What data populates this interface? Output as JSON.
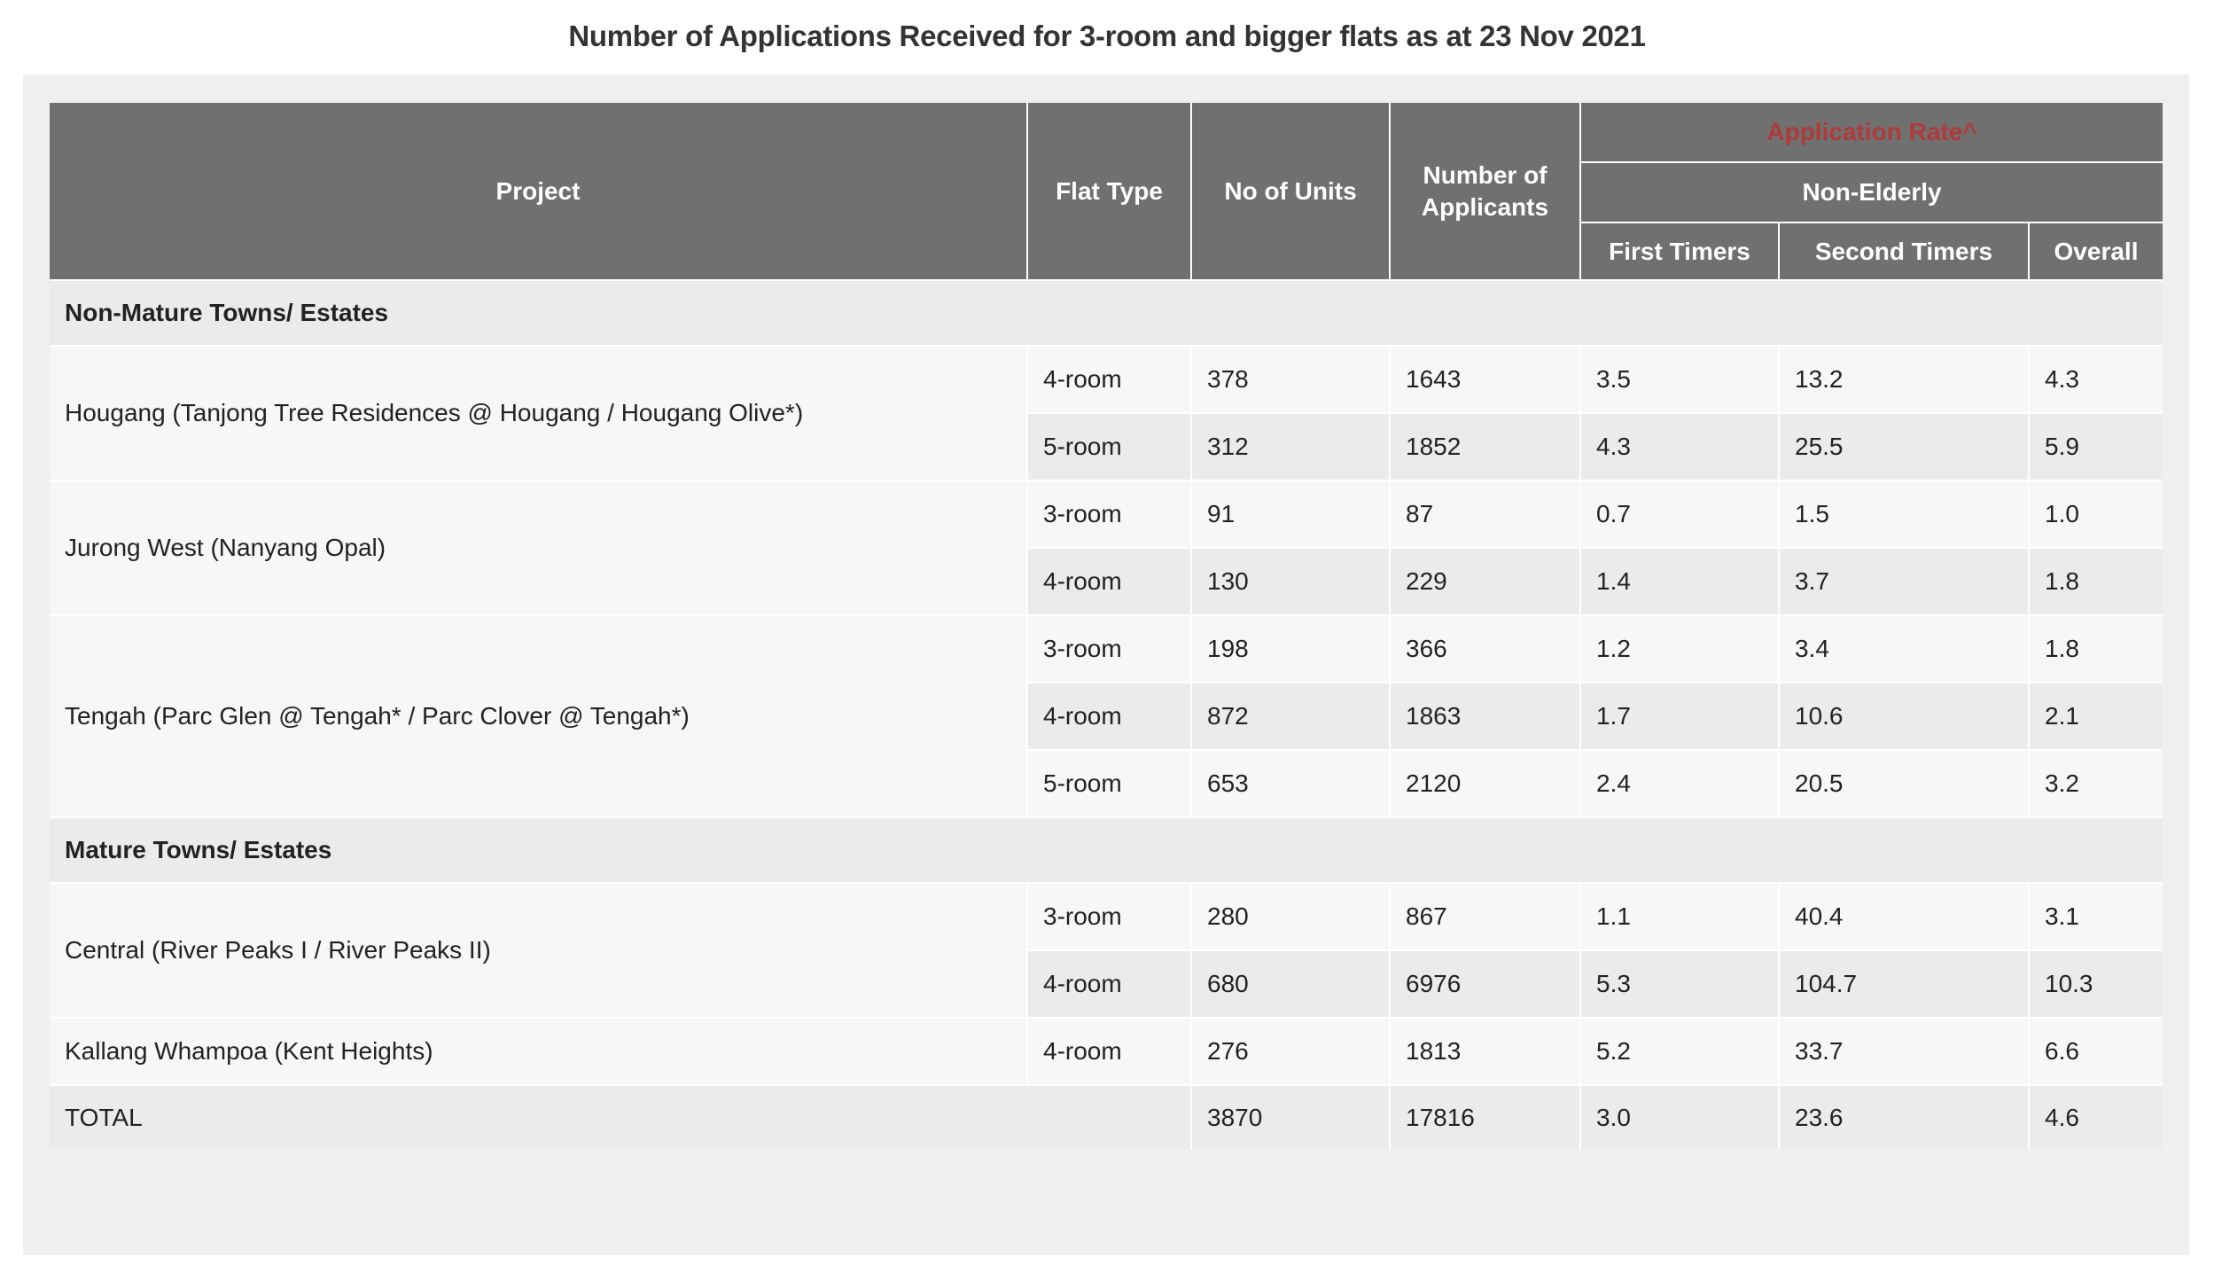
{
  "page": {
    "title": "Number of Applications Received for 3-room and bigger flats as at 23 Nov 2021"
  },
  "colors": {
    "header_bg": "#707070",
    "header_text": "#ffffff",
    "accent_red": "#b03a3a",
    "panel_bg": "#efefef",
    "row_light": "#f7f7f7",
    "row_dark": "#ebebeb"
  },
  "table": {
    "headers": {
      "project": "Project",
      "flat_type": "Flat Type",
      "no_of_units": "No of Units",
      "number_of_applicants": "Number of Applicants",
      "application_rate": "Application Rate^",
      "non_elderly": "Non-Elderly",
      "first_timers": "First Timers",
      "second_timers": "Second Timers",
      "overall": "Overall"
    },
    "sections": [
      {
        "title": "Non-Mature Towns/ Estates",
        "projects": [
          {
            "name": "Hougang (Tanjong Tree Residences @ Hougang / Hougang Olive*)",
            "rows": [
              {
                "flat_type": "4-room",
                "units": "378",
                "applicants": "1643",
                "first_timers": "3.5",
                "second_timers": "13.2",
                "overall": "4.3"
              },
              {
                "flat_type": "5-room",
                "units": "312",
                "applicants": "1852",
                "first_timers": "4.3",
                "second_timers": "25.5",
                "overall": "5.9"
              }
            ]
          },
          {
            "name": "Jurong West (Nanyang Opal)",
            "rows": [
              {
                "flat_type": "3-room",
                "units": "91",
                "applicants": "87",
                "first_timers": "0.7",
                "second_timers": "1.5",
                "overall": "1.0"
              },
              {
                "flat_type": "4-room",
                "units": "130",
                "applicants": "229",
                "first_timers": "1.4",
                "second_timers": "3.7",
                "overall": "1.8"
              }
            ]
          },
          {
            "name": "Tengah (Parc Glen @ Tengah* / Parc Clover @ Tengah*)",
            "rows": [
              {
                "flat_type": "3-room",
                "units": "198",
                "applicants": "366",
                "first_timers": "1.2",
                "second_timers": "3.4",
                "overall": "1.8"
              },
              {
                "flat_type": "4-room",
                "units": "872",
                "applicants": "1863",
                "first_timers": "1.7",
                "second_timers": "10.6",
                "overall": "2.1"
              },
              {
                "flat_type": "5-room",
                "units": "653",
                "applicants": "2120",
                "first_timers": "2.4",
                "second_timers": "20.5",
                "overall": "3.2"
              }
            ]
          }
        ]
      },
      {
        "title": "Mature Towns/ Estates",
        "projects": [
          {
            "name": "Central (River Peaks I / River Peaks II)",
            "rows": [
              {
                "flat_type": "3-room",
                "units": "280",
                "applicants": "867",
                "first_timers": "1.1",
                "second_timers": "40.4",
                "overall": "3.1"
              },
              {
                "flat_type": "4-room",
                "units": "680",
                "applicants": "6976",
                "first_timers": "5.3",
                "second_timers": "104.7",
                "overall": "10.3"
              }
            ]
          },
          {
            "name": "Kallang Whampoa (Kent Heights)",
            "rows": [
              {
                "flat_type": "4-room",
                "units": "276",
                "applicants": "1813",
                "first_timers": "5.2",
                "second_timers": "33.7",
                "overall": "6.6"
              }
            ]
          }
        ]
      }
    ],
    "total": {
      "label": "TOTAL",
      "units": "3870",
      "applicants": "17816",
      "first_timers": "3.0",
      "second_timers": "23.6",
      "overall": "4.6"
    }
  }
}
